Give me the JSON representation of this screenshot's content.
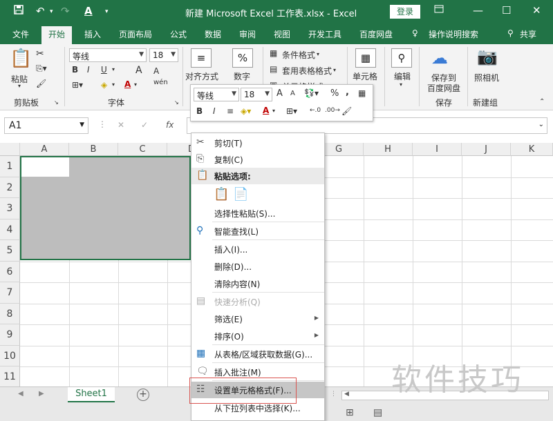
{
  "window": {
    "title": "新建 Microsoft Excel 工作表.xlsx  -  Excel",
    "login": "登录",
    "qa_save": "save-icon",
    "qa_undo": "undo-icon",
    "qa_redo": "redo-icon",
    "qa_font_color": "A"
  },
  "tabs": [
    "文件",
    "开始",
    "插入",
    "页面布局",
    "公式",
    "数据",
    "审阅",
    "视图",
    "开发工具",
    "百度网盘",
    "操作说明搜索",
    "共享"
  ],
  "ribbon": {
    "paste": "粘贴",
    "clipboard_group": "剪贴板",
    "font_name": "等线",
    "font_size": "18",
    "font_group": "字体",
    "bold": "B",
    "italic": "I",
    "underline": "U",
    "grow_font": "A",
    "shrink_font": "A",
    "wen": "wén",
    "align": "对齐方式",
    "number": "数字",
    "percent": "%",
    "cond_format": "条件格式",
    "table_format": "套用表格格式",
    "cell_style": "单元格样式",
    "cells": "单元格",
    "edit": "编辑",
    "save_baidu_1": "保存到",
    "save_baidu_2": "百度网盘",
    "save_group": "保存",
    "camera": "照相机",
    "new_group": "新建组"
  },
  "formula_bar": {
    "name_box": "A1",
    "cancel": "✕",
    "confirm": "✓",
    "fx": "fx"
  },
  "columns": [
    "A",
    "B",
    "C",
    "D",
    "E",
    "F",
    "G",
    "H",
    "I",
    "J",
    "K"
  ],
  "rows": [
    "1",
    "2",
    "3",
    "4",
    "5",
    "6",
    "7",
    "8",
    "9",
    "10",
    "11"
  ],
  "mini_toolbar": {
    "font_name": "等线",
    "font_size": "18",
    "bold": "B",
    "italic": "I",
    "percent": "%",
    "comma": ","
  },
  "context_menu": {
    "cut": "剪切(T)",
    "copy": "复制(C)",
    "paste_options": "粘贴选项:",
    "paste_special": "选择性粘贴(S)...",
    "smart_lookup": "智能查找(L)",
    "insert": "插入(I)...",
    "delete": "删除(D)...",
    "clear": "清除内容(N)",
    "quick_analysis": "快速分析(Q)",
    "filter": "筛选(E)",
    "sort": "排序(O)",
    "get_data": "从表格/区域获取数据(G)...",
    "insert_comment": "插入批注(M)",
    "format_cells": "设置单元格格式(F)...",
    "pick_list": "从下拉列表中选择(K)..."
  },
  "sheet": {
    "tab": "Sheet1",
    "add": "+"
  },
  "watermark": "软件技巧"
}
